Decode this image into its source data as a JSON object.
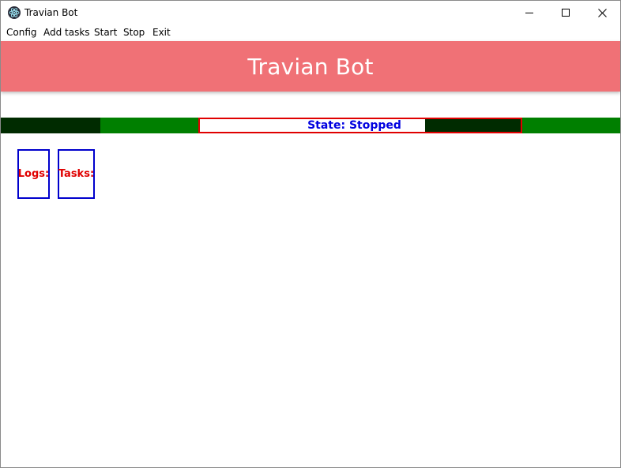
{
  "window": {
    "title": "Travian Bot",
    "app_icon": "electron-atom-icon"
  },
  "menu": {
    "items": [
      "Config",
      "Add tasks",
      "Start",
      "Stop",
      "Exit"
    ]
  },
  "header": {
    "title": "Travian Bot",
    "color": "#f07176"
  },
  "state": {
    "text": "State: Stopped",
    "text_color": "#0000e0",
    "border_color": "#e00000",
    "segment_colors": [
      "#002b00",
      "#007f00",
      "#ffffff",
      "#002b00",
      "#007f00"
    ]
  },
  "panels": {
    "logs_label": "Logs:",
    "tasks_label": "Tasks:"
  }
}
